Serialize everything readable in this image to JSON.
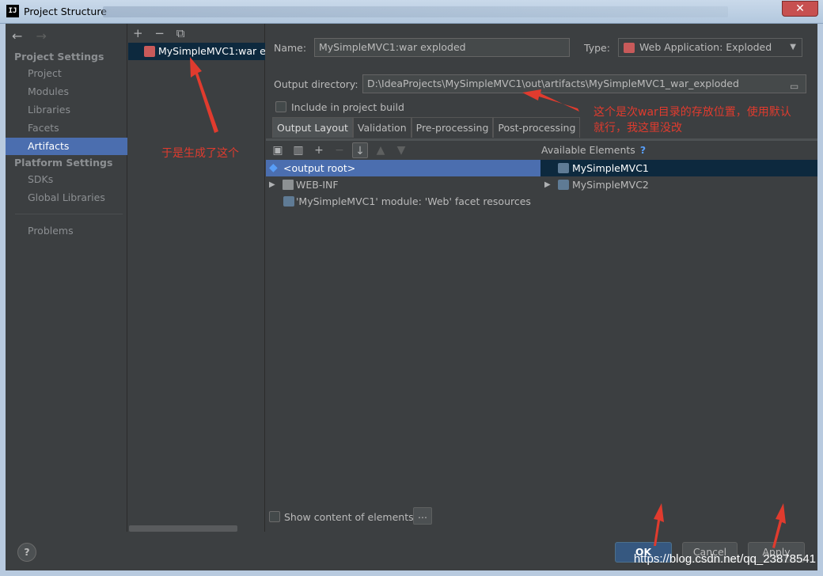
{
  "window": {
    "title": "Project Structure",
    "close_label": "✕",
    "app_icon": "IJ"
  },
  "nav": {
    "back": "←",
    "forward": "→",
    "project_settings_header": "Project Settings",
    "platform_settings_header": "Platform Settings",
    "items": [
      {
        "label": "Project"
      },
      {
        "label": "Modules"
      },
      {
        "label": "Libraries"
      },
      {
        "label": "Facets"
      },
      {
        "label": "Artifacts"
      },
      {
        "label": "SDKs"
      },
      {
        "label": "Global Libraries"
      },
      {
        "label": "Problems"
      }
    ],
    "selected": "Artifacts"
  },
  "artifacts_list": {
    "toolbar": {
      "add": "+",
      "remove": "−",
      "copy": "⧉"
    },
    "items": [
      {
        "label": "MySimpleMVC1:war exploded"
      }
    ]
  },
  "detail": {
    "name_label": "Name:",
    "name_value": "MySimpleMVC1:war exploded",
    "type_label": "Type:",
    "type_value": "Web Application: Exploded",
    "output_dir_label": "Output directory:",
    "output_dir_value": "D:\\IdeaProjects\\MySimpleMVC1\\out\\artifacts\\MySimpleMVC1_war_exploded",
    "include_build_label": "Include in project build",
    "tabs": [
      {
        "label": "Output Layout"
      },
      {
        "label": "Validation"
      },
      {
        "label": "Pre-processing"
      },
      {
        "label": "Post-processing"
      }
    ],
    "active_tab": "Output Layout",
    "layout_tree": [
      {
        "label": "<output root>",
        "icon": "output-root-icon",
        "selected": true
      },
      {
        "label": "WEB-INF",
        "icon": "folder-icon",
        "expandable": true
      },
      {
        "label": "'MySimpleMVC1' module: 'Web' facet resources",
        "icon": "web-facet-icon"
      }
    ],
    "available_header": "Available Elements",
    "available_help": "?",
    "available": [
      {
        "label": "MySimpleMVC1",
        "selected": true
      },
      {
        "label": "MySimpleMVC2",
        "expandable": true
      }
    ],
    "show_content_label": "Show content of elements",
    "dots_label": "..."
  },
  "footer": {
    "help": "?",
    "ok": "OK",
    "cancel": "Cancel",
    "apply": "Apply"
  },
  "annotations": {
    "left_note": "于是生成了这个",
    "right_note_line1": "这个是次war目录的存放位置，使用默认",
    "right_note_line2": "就行，我这里没改",
    "color": "#e03b2e"
  },
  "watermark": "https://blog.csdn.net/qq_23878541",
  "colors": {
    "selection": "#4b6eaf",
    "primary_button": "#365880",
    "background": "#3c3f41"
  }
}
